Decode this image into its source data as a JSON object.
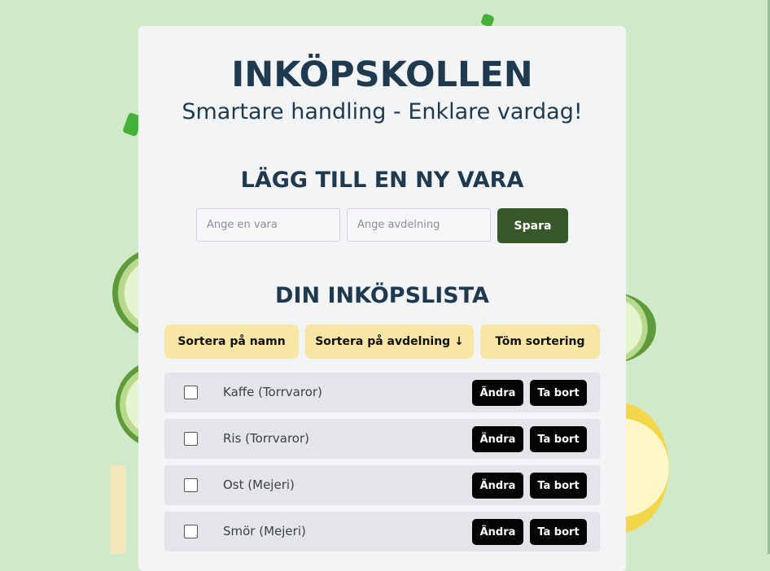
{
  "header": {
    "title": "INKÖPSKOLLEN",
    "tagline": "Smartare handling - Enklare vardag!"
  },
  "add_section": {
    "heading": "LÄGG TILL EN NY VARA",
    "item_placeholder": "Ange en vara",
    "department_placeholder": "Ange avdelning",
    "save_label": "Spara"
  },
  "list_section": {
    "heading": "DIN INKÖPSLISTA",
    "sort_by_name": "Sortera på namn",
    "sort_by_department": "Sortera på avdelning ↓",
    "clear_sort": "Töm sortering"
  },
  "items": [
    {
      "label": "Kaffe (Torrvaror)",
      "checked": false
    },
    {
      "label": "Ris (Torrvaror)",
      "checked": false
    },
    {
      "label": "Ost (Mejeri)",
      "checked": false
    },
    {
      "label": "Smör (Mejeri)",
      "checked": false
    }
  ],
  "row_actions": {
    "edit_label": "Ändra",
    "delete_label": "Ta bort"
  },
  "colors": {
    "background": "#cfe9c9",
    "card": "#f2f4f5",
    "heading": "#1f3a4f",
    "save_button": "#37592a",
    "sort_button": "#f8e6a4",
    "row": "#e3e5e8",
    "action_button": "#050505"
  }
}
